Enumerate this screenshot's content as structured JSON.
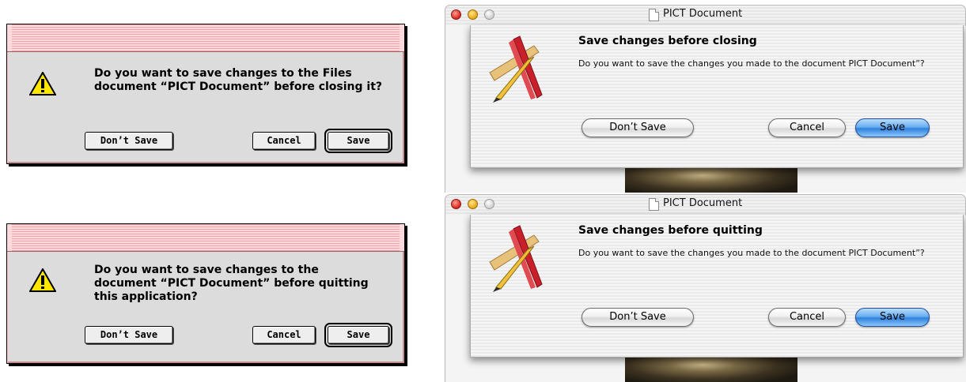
{
  "classic_dialogs": [
    {
      "message": "Do you want to save changes to the Files document “PICT Document” before closing it?",
      "buttons": {
        "dont_save": "Don’t Save",
        "cancel": "Cancel",
        "save": "Save"
      }
    },
    {
      "message": "Do you want to save changes to the document “PICT Document” before quitting this application?",
      "buttons": {
        "dont_save": "Don’t Save",
        "cancel": "Cancel",
        "save": "Save"
      }
    }
  ],
  "aqua_sheets": [
    {
      "window_title": "PICT Document",
      "title": "Save changes before closing",
      "message": "Do you want to save the changes you made to the document PICT Document”?",
      "buttons": {
        "dont_save": "Don’t Save",
        "cancel": "Cancel",
        "save": "Save"
      }
    },
    {
      "window_title": "PICT Document",
      "title": "Save changes before quitting",
      "message": "Do you want to save the changes you made to the document PICT Document”?",
      "buttons": {
        "dont_save": "Don’t Save",
        "cancel": "Cancel",
        "save": "Save"
      }
    }
  ],
  "colors": {
    "classic_titlebar_stripe": "#f4a0a8",
    "classic_body": "#dcdcdc",
    "aqua_default_button": "#2f82de",
    "traffic_red": "#d8241b",
    "traffic_yellow": "#e7a712"
  },
  "icons": {
    "classic": "caution-triangle-icon",
    "aqua": "application-pencil-ruler-icon"
  }
}
